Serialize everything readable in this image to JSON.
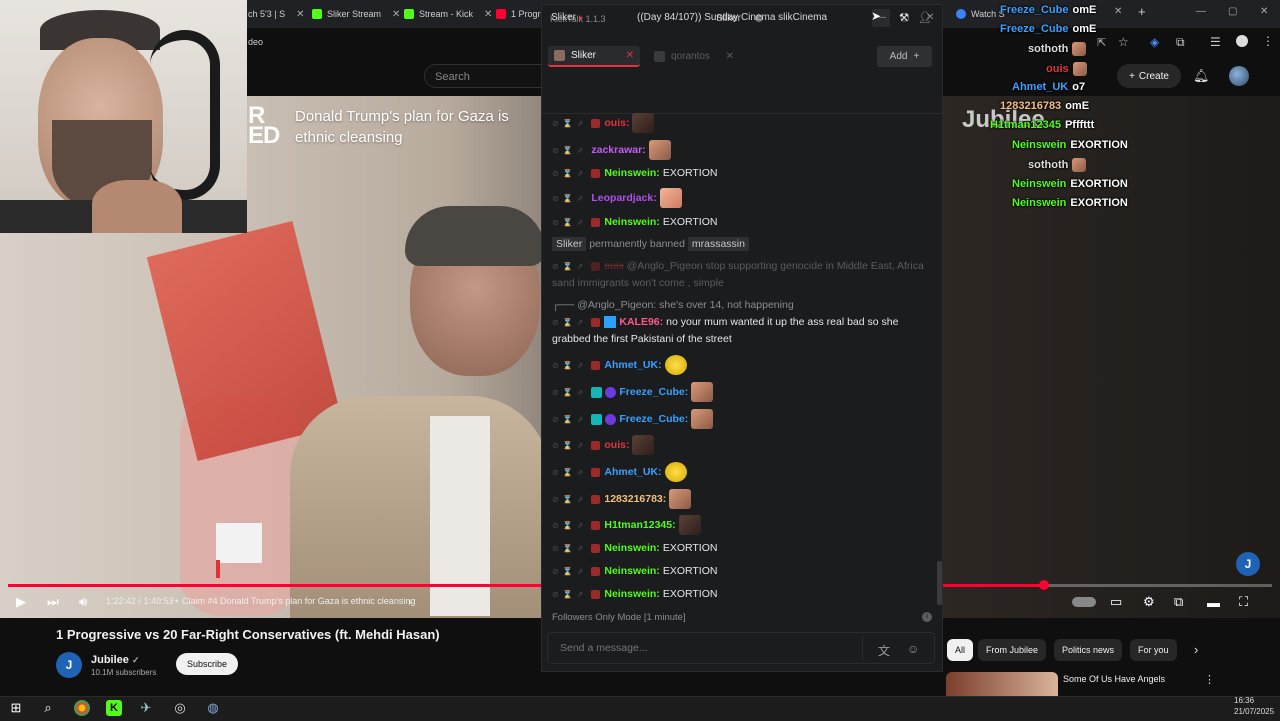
{
  "browser": {
    "tabs": [
      {
        "label": "ch 5'3 | S",
        "color": "#444"
      },
      {
        "label": "Sliker Stream",
        "color": "#53fc18"
      },
      {
        "label": "Stream - Kick",
        "color": "#53fc18"
      },
      {
        "label": "1 Progre",
        "color": "#ff0033"
      },
      {
        "label": "Watch S",
        "color": "#3b82f6"
      }
    ],
    "address_partial": "deo"
  },
  "youtube": {
    "search_placeholder": "Search",
    "create_label": "Create",
    "video_overlay_brand": "R\nED",
    "video_overlay_title": "Donald Trump's plan for Gaza is ethnic cleansing",
    "watermark": "Jubilee",
    "badge_letter": "J",
    "player": {
      "current_time": "1:22:42 / 1:40:53",
      "chapter": "Claim #4 Donald Trump's plan for Gaza is ethnic cleansing",
      "progress_fraction": 0.82
    },
    "video_title": "1 Progressive vs 20 Far-Right Conservatives (ft. Mehdi Hasan)",
    "channel": {
      "name": "Jubilee",
      "subscribers": "10.1M subscribers",
      "avatar_letter": "J"
    },
    "subscribe_label": "Subscribe",
    "chips": [
      "All",
      "From Jubilee",
      "Politics news",
      "For you"
    ],
    "recommended_title": "Some Of Us Have Angels"
  },
  "kicktalk": {
    "app_title": "KickTalk 1.1.3",
    "user": "Sliker",
    "tabs": [
      {
        "label": "Sliker"
      },
      {
        "label": "qorantos"
      }
    ],
    "add_label": "Add",
    "channel_name": "Sliker",
    "stream_title": "((Day 84/107)) Sunday Cinema slikCinema",
    "followers_mode": "Followers Only Mode [1 minute]",
    "input_placeholder": "Send a message...",
    "messages": [
      {
        "user": "ouis:",
        "color": "#e4323e",
        "text": "",
        "emote": "dark"
      },
      {
        "user": "zackrawar:",
        "color": "#c55df2",
        "text": "",
        "emote": "face"
      },
      {
        "user": "Neinswein:",
        "color": "#53fc18",
        "text": "EXORTION",
        "emote": ""
      },
      {
        "user": "Leopardjack:",
        "color": "#b34df0",
        "text": "",
        "emote": "hand"
      },
      {
        "user": "Neinswein:",
        "color": "#53fc18",
        "text": "EXORTION",
        "emote": ""
      },
      {
        "user": "Anglo_Pigeon",
        "color": "#5a5c61",
        "text": "stop supporting genocide in Middle East, Africa sand immigrants won't come , simple",
        "emote": ""
      },
      {
        "user": "@Anglo_Pigeon:",
        "color": "#8b8d92",
        "text": "she's over 14, not happening",
        "emote": ""
      },
      {
        "user": "KALE96:",
        "color": "#ff5a8a",
        "text": "no your mum wanted it up the ass real bad so she grabbed the first Pakistani of the street",
        "emote": ""
      },
      {
        "user": "Ahmet_UK:",
        "color": "#3aa0ff",
        "text": "",
        "emote": "yellow"
      },
      {
        "user": "Freeze_Cube:",
        "color": "#3aa0ff",
        "text": "",
        "emote": "face"
      },
      {
        "user": "Freeze_Cube:",
        "color": "#3aa0ff",
        "text": "",
        "emote": "face"
      },
      {
        "user": "ouis:",
        "color": "#e4323e",
        "text": "",
        "emote": "dark"
      },
      {
        "user": "Ahmet_UK:",
        "color": "#3aa0ff",
        "text": "",
        "emote": "yellow"
      },
      {
        "user": "1283216783:",
        "color": "#f0c080",
        "text": "",
        "emote": "face"
      },
      {
        "user": "H1tman12345:",
        "color": "#53fc18",
        "text": "",
        "emote": "dark"
      },
      {
        "user": "Neinswein:",
        "color": "#53fc18",
        "text": "EXORTION",
        "emote": ""
      },
      {
        "user": "Neinswein:",
        "color": "#53fc18",
        "text": "EXORTION",
        "emote": ""
      },
      {
        "user": "Neinswein:",
        "color": "#53fc18",
        "text": "EXORTION",
        "emote": ""
      }
    ],
    "ban_notice": {
      "actor": "Sliker",
      "text": "permanently banned",
      "target": "mrassassin"
    },
    "deleted_prefix": "@Anglo_Pigeon"
  },
  "overlay_chat": [
    {
      "user": "Freeze_Cube",
      "color": "#3aa0ff",
      "text": "omE"
    },
    {
      "user": "Freeze_Cube",
      "color": "#3aa0ff",
      "text": "omE"
    },
    {
      "user": "sothoth",
      "color": "#dddddd",
      "text": ""
    },
    {
      "user": "ouis",
      "color": "#e4323e",
      "text": ""
    },
    {
      "user": "Ahmet_UK",
      "color": "#3aa0ff",
      "text": "o7"
    },
    {
      "user": "1283216783",
      "color": "#f0c080",
      "text": "omE"
    },
    {
      "user": "H1tman12345",
      "color": "#53fc18",
      "text": "Pfffttt"
    },
    {
      "user": "Neinswein",
      "color": "#53fc18",
      "text": "EXORTION"
    },
    {
      "user": "sothoth",
      "color": "#dddddd",
      "text": ""
    },
    {
      "user": "Neinswein",
      "color": "#53fc18",
      "text": "EXORTION"
    },
    {
      "user": "Neinswein",
      "color": "#53fc18",
      "text": "EXORTION"
    }
  ],
  "taskbar": {
    "time": "16:36",
    "date": "21/07/2025"
  }
}
